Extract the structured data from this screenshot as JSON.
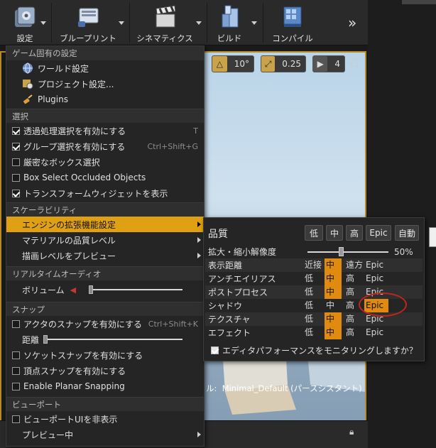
{
  "toolbar": {
    "buttons": [
      {
        "label": "設定",
        "icon": "gear-icon"
      },
      {
        "label": "ブループリント",
        "icon": "blueprint-icon"
      },
      {
        "label": "シネマティクス",
        "icon": "clapperboard-icon"
      },
      {
        "label": "ビルド",
        "icon": "build-blocks-icon"
      },
      {
        "label": "コンパイル",
        "icon": "compile-icon"
      }
    ],
    "more": "»"
  },
  "viewport": {
    "grid_snap_value": "10°",
    "rotation_snap_value": "0.25",
    "camera_speed": "4",
    "level_prefix": "ル:",
    "level_name": "Minimal_Default (パースシスタント)"
  },
  "menu": {
    "game_specific_header": "ゲーム固有の設定",
    "world_settings": "ワールド設定",
    "project_settings": "プロジェクト設定...",
    "plugins": "Plugins",
    "selection_header": "選択",
    "translucent_select": "透過処理選択を有効にする",
    "translucent_shortcut": "T",
    "group_select": "グループ選択を有効にする",
    "group_shortcut": "Ctrl+Shift+G",
    "strict_box": "厳密なボックス選択",
    "box_occluded": "Box Select Occluded Objects",
    "transform_widget": "トランスフォームウィジェットを表示",
    "scalability_header": "スケーラビリティ",
    "engine_scalability": "エンジンの拡張機能設定",
    "material_quality": "マテリアルの品質レベル",
    "preview_rendering": "描画レベルをプレビュー",
    "realtime_audio_header": "リアルタイムオーディオ",
    "volume": "ボリューム",
    "snap_header": "スナップ",
    "actor_snap": "アクタのスナップを有効にする",
    "actor_snap_shortcut": "Ctrl+Shift+K",
    "distance": "距離",
    "socket_snap": "ソケットスナップを有効にする",
    "vertex_snap": "頂点スナップを有効にする",
    "planar_snap": "Enable Planar Snapping",
    "viewport_header": "ビューポート",
    "hide_viewport_ui": "ビューポートUIを非表示",
    "preview": "プレビュー中",
    "volume_level": 0.0,
    "distance_level": 0.0
  },
  "quality": {
    "title": "品質",
    "presets": [
      "低",
      "中",
      "高",
      "Epic",
      "自動"
    ],
    "resolution_label": "拡大・縮小解像度",
    "resolution_value": "50%",
    "resolution_level": 0.5,
    "rows": [
      {
        "label": "表示距離",
        "options": [
          "近接",
          "中",
          "遠方",
          "Epic"
        ],
        "selected": 1
      },
      {
        "label": "アンチエイリアス",
        "options": [
          "低",
          "中",
          "高",
          "Epic"
        ],
        "selected": 1
      },
      {
        "label": "ポストプロセス",
        "options": [
          "低",
          "中",
          "高",
          "Epic"
        ],
        "selected": 1
      },
      {
        "label": "シャドウ",
        "options": [
          "低",
          "中",
          "高",
          "Epic"
        ],
        "selected": 3
      },
      {
        "label": "テクスチャ",
        "options": [
          "低",
          "中",
          "高",
          "Epic"
        ],
        "selected": 1
      },
      {
        "label": "エフェクト",
        "options": [
          "低",
          "中",
          "高",
          "Epic"
        ],
        "selected": 1
      }
    ],
    "monitor_label": "エディタパフォーマンスをモニタリングしますか？"
  },
  "colors": {
    "highlight": "#e0a013",
    "selected_option": "#e08a10",
    "annotation": "#c0261c"
  }
}
